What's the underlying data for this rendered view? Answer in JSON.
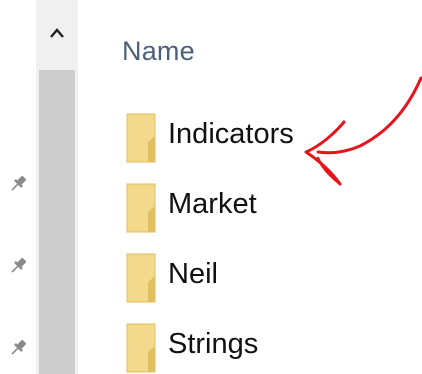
{
  "file_list": {
    "column_header": "Name",
    "items": [
      {
        "name": "Indicators",
        "type": "folder"
      },
      {
        "name": "Market",
        "type": "folder"
      },
      {
        "name": "Neil",
        "type": "folder"
      },
      {
        "name": "Strings",
        "type": "folder"
      }
    ]
  },
  "nav_pane": {
    "pin_icons": [
      "pin-icon",
      "pin-icon",
      "pin-icon"
    ]
  },
  "scrollbar": {
    "up_arrow_icon": "chevron-up-icon"
  },
  "annotation": {
    "color": "#e8141b",
    "target": "Indicators"
  },
  "colors": {
    "folder": "#f3d98b",
    "folder_dark": "#e0bf62",
    "header_text": "#4c607a",
    "scrollbar_track": "#f0f0f0",
    "scrollbar_thumb": "#cdcdcd"
  }
}
